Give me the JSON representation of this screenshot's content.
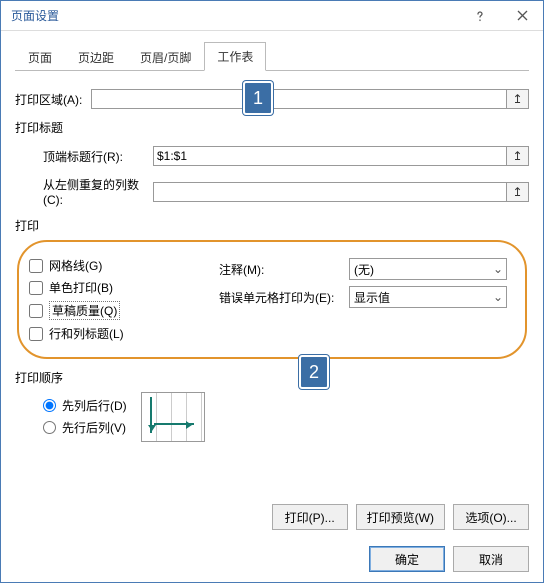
{
  "title": "页面设置",
  "tabs": [
    "页面",
    "页边距",
    "页眉/页脚",
    "工作表"
  ],
  "activeTab": 3,
  "callouts": {
    "c1": "1",
    "c2": "2"
  },
  "printArea": {
    "label": "打印区域(A):",
    "value": ""
  },
  "titlesGroup": "打印标题",
  "topRows": {
    "label": "顶端标题行(R):",
    "value": "$1:$1"
  },
  "leftCols": {
    "label": "从左侧重复的列数(C):",
    "value": ""
  },
  "printGroup": "打印",
  "checks": {
    "grid": {
      "label": "网格线(G)",
      "checked": false
    },
    "mono": {
      "label": "单色打印(B)",
      "checked": false
    },
    "draft": {
      "label": "草稿质量(Q)",
      "checked": false
    },
    "rowc": {
      "label": "行和列标题(L)",
      "checked": false
    }
  },
  "comments": {
    "label": "注释(M):",
    "value": "(无)"
  },
  "errors": {
    "label": "错误单元格打印为(E):",
    "value": "显示值"
  },
  "orderGroup": "打印顺序",
  "orderOpts": {
    "downOver": {
      "label": "先列后行(D)",
      "checked": true
    },
    "overDown": {
      "label": "先行后列(V)",
      "checked": false
    }
  },
  "buttons": {
    "print": "打印(P)...",
    "preview": "打印预览(W)",
    "options": "选项(O)...",
    "ok": "确定",
    "cancel": "取消"
  }
}
